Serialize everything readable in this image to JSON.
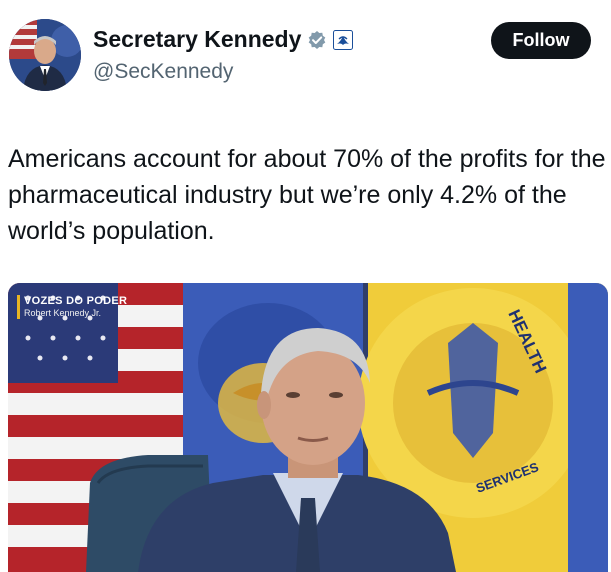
{
  "author": {
    "name": "Secretary Kennedy",
    "handle": "@SecKennedy",
    "verified_badge_icon": "verified-gray-check-icon",
    "affiliation_icon": "hhs-eagle-icon"
  },
  "follow_button": {
    "label": "Follow"
  },
  "tweet": {
    "text": "Americans account for about 70% of the profits for the pharmaceutical industry but we’re only 4.2% of the world’s population."
  },
  "media": {
    "overlay_title": "VOZES DO PODER",
    "overlay_subtitle": "Robert Kennedy Jr.",
    "flag_text": "HEALTH",
    "flag_text_2": "SERVICES"
  },
  "colors": {
    "follow_bg": "#0f1419",
    "handle_gray": "#536471",
    "overlay_accent": "#e8b423"
  }
}
